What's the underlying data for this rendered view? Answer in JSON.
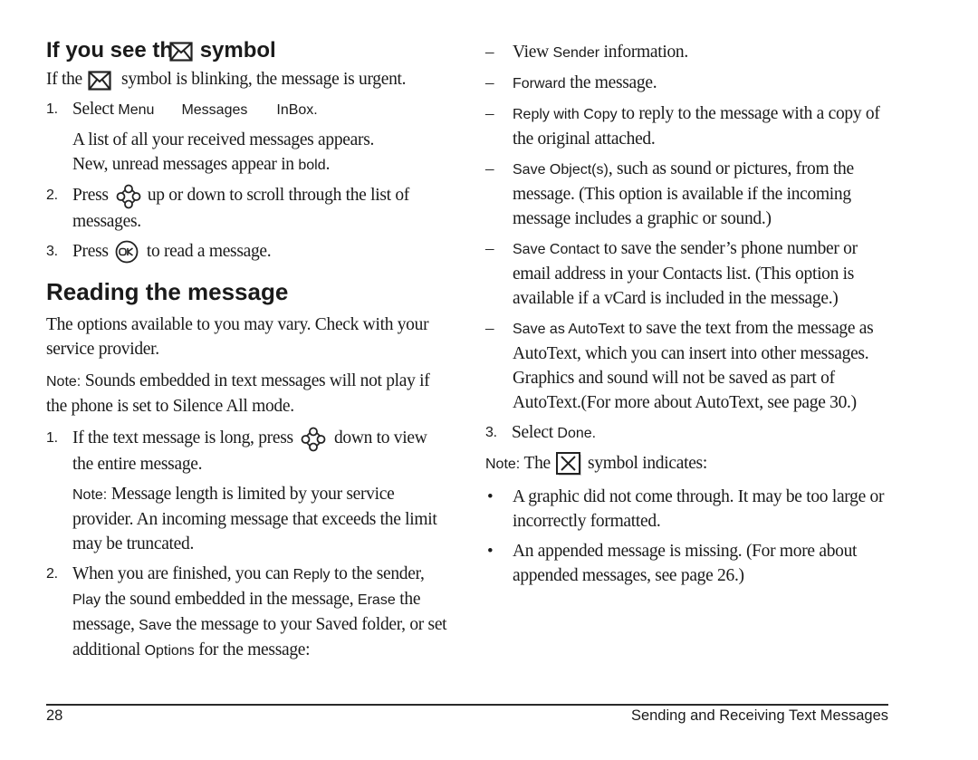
{
  "left": {
    "section1": {
      "title_prefix": "If you see th",
      "title_suffix": " symbol",
      "title_icon": "envelope-icon",
      "intro_prefix": "If the ",
      "intro_suffix": " symbol is blinking, the message is urgent.",
      "steps": [
        {
          "num": "1.",
          "text_prefix": "Select ",
          "menu_path": [
            "Menu",
            "Messages",
            "InBox"
          ],
          "text_suffix": ".",
          "detail_line1": "A list of all your received messages appears.",
          "detail_line2_prefix": "New, unread messages appear in ",
          "detail_line2_ui": "bold",
          "detail_line2_suffix": "."
        },
        {
          "num": "2.",
          "text_prefix": "Press ",
          "icon": "navigation-key-icon",
          "text_suffix": " up or down to scroll through the list of messages."
        },
        {
          "num": "3.",
          "text_prefix": "Press ",
          "icon": "ok-key-icon",
          "text_suffix": " to read a message."
        }
      ]
    },
    "section2": {
      "title": "Reading the message",
      "intro": "The options available to you may vary. Check with your service provider.",
      "note_label": "Note:",
      "note_text": " Sounds embedded in text messages will not play if the phone is set to Silence All mode.",
      "steps": [
        {
          "num": "1.",
          "text_prefix": "If the text message is long, press ",
          "icon": "navigation-key-icon",
          "text_suffix": " down to view the entire message.",
          "note_label": "Note:",
          "note_text": " Message length is limited by your service provider. An incoming message that exceeds the limit may be truncated."
        },
        {
          "num": "2.",
          "t1": "When you are finished, you can ",
          "ui1": "Reply",
          "t2": " to the sender, ",
          "ui2": "Play",
          "t3": " the sound embedded in the message, ",
          "ui3": "Erase",
          "t4": " the message, ",
          "ui4": "Save",
          "t5": " the message to your Saved folder, or set additional ",
          "ui5": "Options",
          "t6": " for the message:"
        }
      ]
    }
  },
  "right": {
    "options": [
      {
        "prefix": "View ",
        "ui": "Sender",
        "text": " information."
      },
      {
        "prefix": "",
        "ui": "Forward",
        "text": " the message."
      },
      {
        "prefix": "",
        "ui": "Reply with Copy",
        "text": " to reply to the message with a copy of the original attached."
      },
      {
        "prefix": "",
        "ui": "Save Object(s)",
        "text": ", such as sound or pictures, from the message. (This option is available if the incoming message includes a graphic or sound.)"
      },
      {
        "prefix": "",
        "ui": "Save Contact",
        "text": " to save the sender’s phone number or email address in your Contacts list. (This option is available if a vCard is included in the message.)"
      },
      {
        "prefix": "",
        "ui": "Save as AutoText",
        "text": " to save the text from the message as AutoText, which you can insert into other messages. Graphics and sound will not be saved as part of AutoText.(For more about AutoText, see page 30.)"
      }
    ],
    "step3": {
      "num": "3.",
      "prefix": "Select ",
      "ui": "Done",
      "suffix": "."
    },
    "note": {
      "label": "Note:",
      "prefix": " The ",
      "icon": "broken-graphic-icon",
      "suffix": " symbol indicates:",
      "bullets": [
        "A graphic did not come through. It may be too large or incorrectly formatted.",
        "An appended message is missing. (For more about appended messages, see page 26.)"
      ]
    },
    "dash_char": "–",
    "bullet_char": "•"
  },
  "footer": {
    "page_number": "28",
    "chapter_title": "Sending and Receiving Text Messages"
  }
}
